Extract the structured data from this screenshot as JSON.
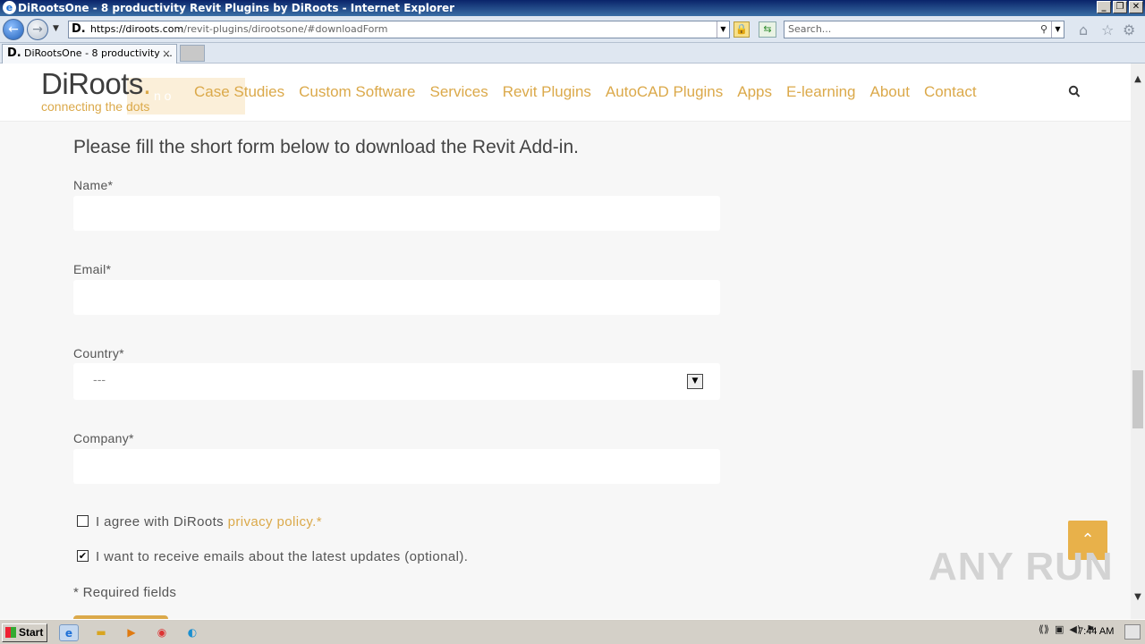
{
  "browser": {
    "window_title": "DiRootsOne - 8 productivity Revit Plugins by DiRoots - Internet Explorer",
    "address_favicon": "D.",
    "url_host": "https://diroots.com",
    "url_path": "/revit-plugins/dirootsone/#downloadForm",
    "search_placeholder": "Search...",
    "tab_label": "DiRootsOne - 8 productivity ...",
    "tab_close": "×"
  },
  "site": {
    "logo_text": "DiRoots",
    "logo_dot": ".",
    "logo_tagline": "connecting the dots",
    "logo_ghost_text": "n o",
    "menu": [
      "Case Studies",
      "Custom Software",
      "Services",
      "Revit Plugins",
      "AutoCAD Plugins",
      "Apps",
      "E-learning",
      "About",
      "Contact"
    ]
  },
  "form": {
    "heading": "Please fill the short form below to download the Revit Add-in.",
    "name_label": "Name*",
    "email_label": "Email*",
    "country_label": "Country*",
    "country_value": "---",
    "company_label": "Company*",
    "privacy_text": "I agree with DiRoots ",
    "privacy_link": "privacy policy.*",
    "privacy_checked": false,
    "updates_text": "I want to receive emails about the latest updates (optional).",
    "updates_checked": true,
    "required_note": "* Required fields"
  },
  "watermark": "ANY RUN",
  "taskbar": {
    "start_label": "Start",
    "clock": "7:44 AM"
  },
  "colors": {
    "accent": "#dba94a",
    "page_bg": "#f7f7f7"
  }
}
